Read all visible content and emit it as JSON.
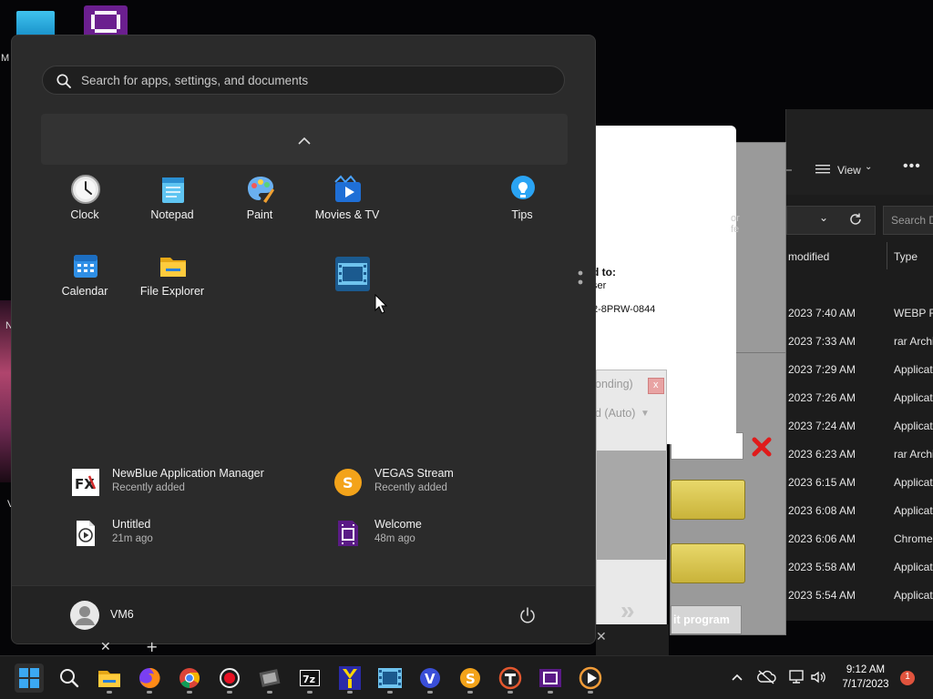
{
  "start_menu": {
    "search_placeholder": "Search for apps, settings, and documents",
    "pinned": [
      {
        "label": "Clock"
      },
      {
        "label": "Notepad"
      },
      {
        "label": "Paint"
      },
      {
        "label": "Movies & TV"
      },
      {
        "label": "Tips"
      },
      {
        "label": "Calendar"
      },
      {
        "label": "File Explorer"
      },
      {
        "label": ""
      }
    ],
    "recommended": [
      {
        "title": "NewBlue Application Manager",
        "subtitle": "Recently added",
        "icon": "newblue-fx-icon"
      },
      {
        "title": "VEGAS Stream",
        "subtitle": "Recently added",
        "icon": "vegas-stream-icon"
      },
      {
        "title": "Untitled",
        "subtitle": "21m ago",
        "icon": "video-file-icon"
      },
      {
        "title": "Welcome",
        "subtitle": "48m ago",
        "icon": "vegas-film-icon"
      }
    ],
    "user_name": "VM6"
  },
  "explorer": {
    "view_label": "View",
    "search_placeholder": "Search D",
    "col_modified": "modified",
    "col_type": "Type",
    "rows": [
      {
        "modified": "2023 7:40 AM",
        "type": "WEBP Fi"
      },
      {
        "modified": "2023 7:33 AM",
        "type": "rar Archi"
      },
      {
        "modified": "2023 7:29 AM",
        "type": "Applicat"
      },
      {
        "modified": "2023 7:26 AM",
        "type": "Applicat"
      },
      {
        "modified": "2023 7:24 AM",
        "type": "Applicat"
      },
      {
        "modified": "2023 6:23 AM",
        "type": "rar Archi"
      },
      {
        "modified": "2023 6:15 AM",
        "type": "Applicat"
      },
      {
        "modified": "2023 6:08 AM",
        "type": "Applicat"
      },
      {
        "modified": "2023 6:06 AM",
        "type": "Chrome"
      },
      {
        "modified": "2023 5:58 AM",
        "type": "Applicat"
      },
      {
        "modified": "2023 5:54 AM",
        "type": "Applicat"
      }
    ]
  },
  "dialogs": {
    "white_heading": "d to:",
    "white_line2": "ser",
    "white_code": "2-8PRW-0844",
    "white_faded": "or fe",
    "nr_title": "onding)",
    "nr_select": "d (Auto)",
    "grey_button": "it program"
  },
  "desktop": {
    "label_m": "M",
    "label_n": "N",
    "label_v": "V"
  },
  "taskbar": {
    "time": "9:12 AM",
    "date": "7/17/2023",
    "notification_count": "1"
  },
  "colors": {
    "start_bg": "#2b2b2b",
    "taskbar_bg": "#1c1c1c",
    "accent": "#0078d4",
    "vegas_purple": "#5a1a86",
    "vegas_stream_orange": "#f3a31a"
  }
}
